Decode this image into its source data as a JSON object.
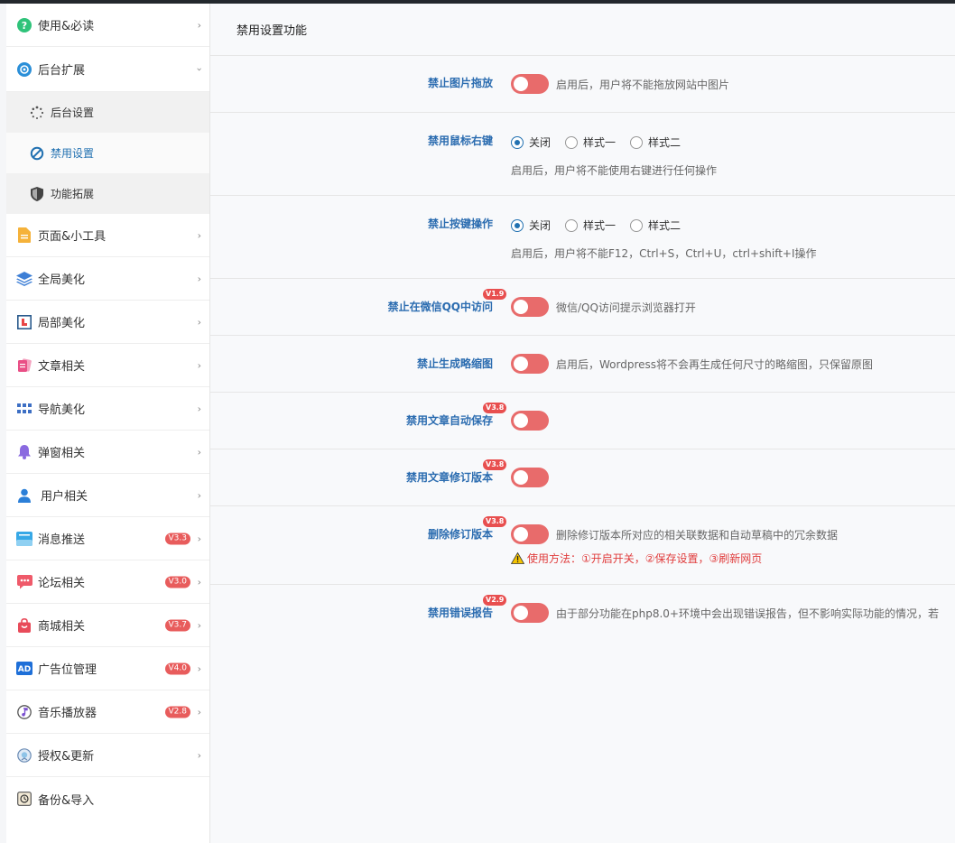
{
  "sidebar": {
    "items": [
      {
        "label": "使用&必读",
        "icon": "help-circle-icon"
      },
      {
        "label": "后台扩展",
        "icon": "gear-badge-icon"
      },
      {
        "label": "页面&小工具",
        "icon": "document-icon"
      },
      {
        "label": "全局美化",
        "icon": "layers-icon"
      },
      {
        "label": "局部美化",
        "icon": "frame-icon"
      },
      {
        "label": "文章相关",
        "icon": "pages-icon"
      },
      {
        "label": "导航美化",
        "icon": "grid-icon"
      },
      {
        "label": "弹窗相关",
        "icon": "bell-icon"
      },
      {
        "label": "用户相关",
        "icon": "user-icon"
      },
      {
        "label": "消息推送",
        "icon": "message-icon",
        "badge": "V3.3"
      },
      {
        "label": "论坛相关",
        "icon": "chat-icon",
        "badge": "V3.0"
      },
      {
        "label": "商城相关",
        "icon": "shopping-bag-icon",
        "badge": "V3.7"
      },
      {
        "label": "广告位管理",
        "icon": "ad-icon",
        "badge": "V4.0"
      },
      {
        "label": "音乐播放器",
        "icon": "music-icon",
        "badge": "V2.8"
      },
      {
        "label": "授权&更新",
        "icon": "badge-icon"
      },
      {
        "label": "备份&导入",
        "icon": "backup-icon"
      }
    ],
    "submenu": [
      {
        "label": "后台设置",
        "icon": "loader-icon"
      },
      {
        "label": "禁用设置",
        "icon": "ban-icon"
      },
      {
        "label": "功能拓展",
        "icon": "shield-icon"
      }
    ]
  },
  "main": {
    "title": "禁用设置功能",
    "rows": [
      {
        "label": "禁止图片拖放",
        "desc": "启用后，用户将不能拖放网站中图片"
      },
      {
        "label": "禁用鼠标右键",
        "options": [
          "关闭",
          "样式一",
          "样式二"
        ],
        "selected": "关闭",
        "desc": "启用后，用户将不能使用右键进行任何操作"
      },
      {
        "label": "禁止按键操作",
        "options": [
          "关闭",
          "样式一",
          "样式二"
        ],
        "selected": "关闭",
        "desc": "启用后，用户将不能F12，Ctrl+S，Ctrl+U，ctrl+shift+I操作"
      },
      {
        "label": "禁止在微信QQ中访问",
        "version": "V1.9",
        "desc": "微信/QQ访问提示浏览器打开"
      },
      {
        "label": "禁止生成略缩图",
        "desc": "启用后，Wordpress将不会再生成任何尺寸的略缩图，只保留原图"
      },
      {
        "label": "禁用文章自动保存",
        "version": "V3.8"
      },
      {
        "label": "禁用文章修订版本",
        "version": "V3.8"
      },
      {
        "label": "删除修订版本",
        "version": "V3.8",
        "desc": "删除修订版本所对应的相关联数据和自动草稿中的冗余数据",
        "warning": "使用方法：①开启开关，②保存设置，③刷新网页"
      },
      {
        "label": "禁用错误报告",
        "version": "V2.9",
        "desc": "由于部分功能在php8.0+环境中会出现错误报告，但不影响实际功能的情况，若"
      }
    ]
  },
  "colors": {
    "accent": "#2271b1",
    "toggle": "#e86b6b",
    "badge": "#e85c5c"
  }
}
